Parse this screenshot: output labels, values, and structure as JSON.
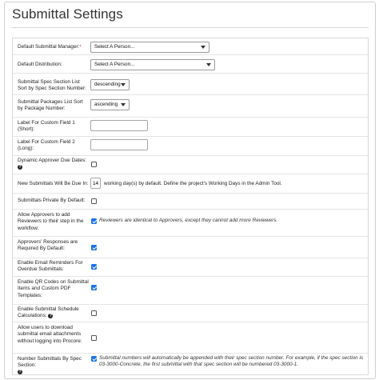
{
  "page": {
    "title": "Submittal Settings"
  },
  "rows": {
    "default_manager": {
      "label": "Default Submittal Manager:",
      "required_mark": "*",
      "select": "Select A Person..."
    },
    "default_distribution": {
      "label": "Default Distribution:",
      "select": "Select A Person..."
    },
    "spec_sort": {
      "label": "Submittal Spec Section List Sort by Spec Section Number:",
      "select": "descending"
    },
    "package_sort": {
      "label": "Submittal Packages List Sort by Package Number:",
      "select": "ascending"
    },
    "custom1": {
      "label": "Label For Custom Field 1 (Short):",
      "value": ""
    },
    "custom2": {
      "label": "Label For Custom Field 2 (Long):",
      "value": ""
    },
    "dynamic_due": {
      "label": "Dynamic Approver Due Dates:",
      "checked": false
    },
    "due_in": {
      "label": "New Submittals Will Be Due In:",
      "value": "14",
      "suffix": "working day(s) by default. Define the project's Working Days in the Admin Tool."
    },
    "private_default": {
      "label": "Submittals Private By Default:",
      "checked": false
    },
    "approver_step": {
      "label": "Allow Approvers to add Reviewers to their step in the workflow:",
      "checked": true,
      "note": "Reviewers are identical to Approvers, except they cannot add more Reviewers."
    },
    "responses_required": {
      "label": "Approvers' Responses are Required By Default:",
      "checked": true
    },
    "email_reminders": {
      "label": "Enable Email Reminders For Overdue Submittals:",
      "checked": true
    },
    "qr_codes": {
      "label": "Enable QR Codes on Submittal Items and Custom PDF Templates:",
      "checked": true
    },
    "schedule_calc": {
      "label": "Enable Submittal Schedule Calculations:",
      "checked": false
    },
    "download_attachments": {
      "label": "Allow users to download submittal email attachments without logging into Procore:",
      "checked": false
    },
    "number_by_spec": {
      "label": "Number Submittals By Spec Section:",
      "checked": true,
      "note": "Submittal numbers will automatically be appended with their spec section number. For example, if the spec section is 03-3000-Concrete, the first submittal with that spec section will be numbered 03-3000-1."
    }
  },
  "icons": {
    "help": "question-circle-icon",
    "caret": "caret-down-icon",
    "check": "checkmark-icon"
  },
  "colors": {
    "checkbox_on": "#1a73e8",
    "required": "#cc0000"
  }
}
